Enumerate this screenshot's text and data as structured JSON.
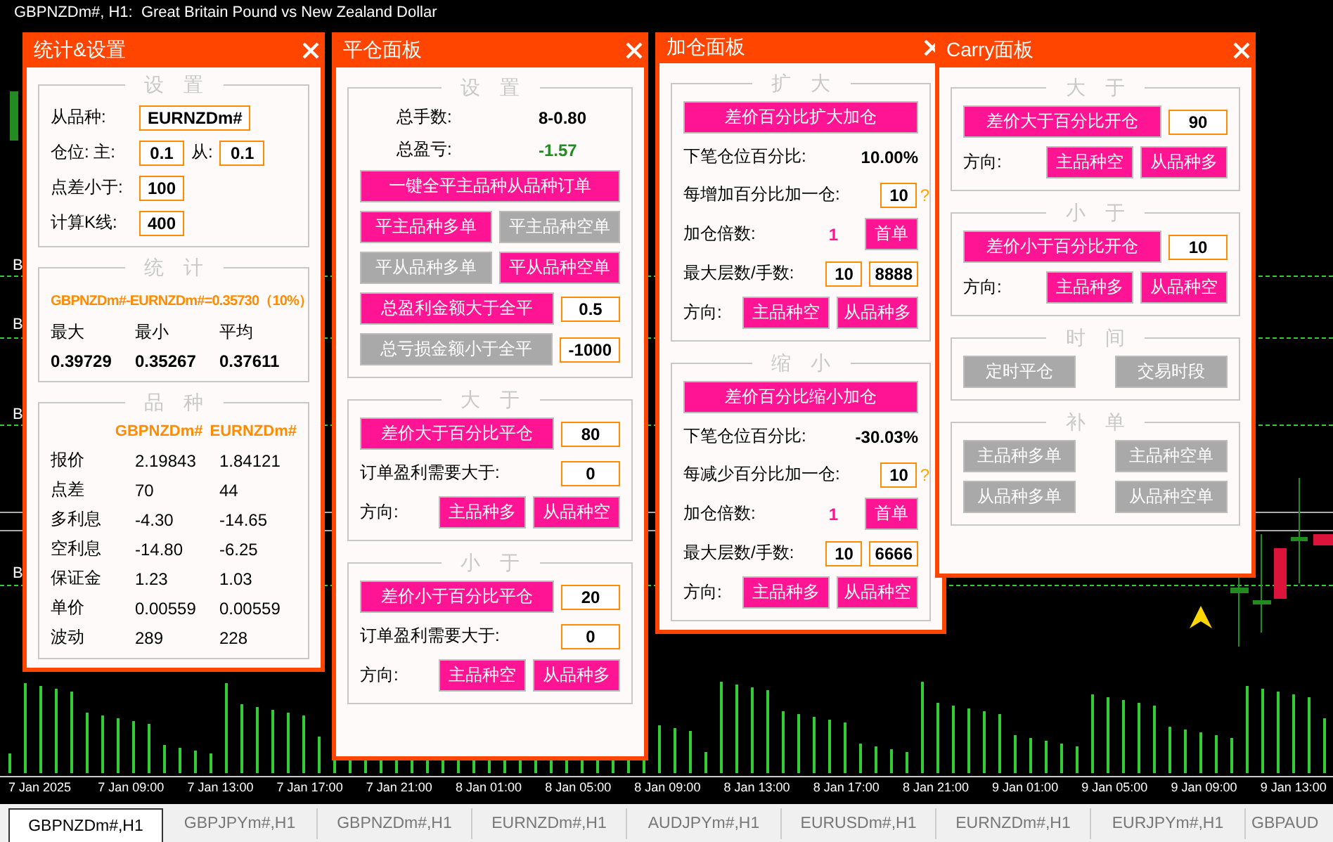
{
  "chart": {
    "title": "GBPNZDm#, H1:  Great Britain Pound vs New Zealand Dollar",
    "level_labels": [
      "B",
      "B",
      "B",
      "B"
    ],
    "time_axis": [
      "7 Jan 2025",
      "7 Jan 09:00",
      "7 Jan 13:00",
      "7 Jan 17:00",
      "7 Jan 21:00",
      "8 Jan 01:00",
      "8 Jan 05:00",
      "8 Jan 09:00",
      "8 Jan 13:00",
      "8 Jan 17:00",
      "8 Jan 21:00",
      "9 Jan 01:00",
      "9 Jan 05:00",
      "9 Jan 09:00",
      "9 Jan 13:00"
    ]
  },
  "panels": [
    {
      "title": "统计&设置",
      "sections": [
        {
          "title": "设置",
          "rows": [
            {
              "kind": "line",
              "items": [
                {
                  "kind": "label",
                  "text": "从品种:"
                },
                {
                  "kind": "field",
                  "value": "EURNZDm#"
                }
              ]
            },
            {
              "kind": "line",
              "items": [
                {
                  "kind": "label",
                  "text": "仓位: 主:"
                },
                {
                  "kind": "field",
                  "value": "0.1"
                },
                {
                  "kind": "label",
                  "text": "从:"
                },
                {
                  "kind": "field",
                  "value": "0.1"
                }
              ]
            },
            {
              "kind": "line",
              "items": [
                {
                  "kind": "label",
                  "text": "点差小于:"
                },
                {
                  "kind": "field",
                  "value": "100"
                }
              ]
            },
            {
              "kind": "line",
              "items": [
                {
                  "kind": "label",
                  "text": "计算K线:"
                },
                {
                  "kind": "field",
                  "value": "400"
                }
              ]
            }
          ]
        },
        {
          "title": "统计",
          "rows": [
            {
              "kind": "line",
              "items": [
                {
                  "kind": "headline",
                  "text": "GBPNZDm#-EURNZDm#=0.35730（10%）"
                }
              ]
            },
            {
              "kind": "grid",
              "items": [
                {
                  "kind": "label",
                  "text": "最大"
                },
                {
                  "kind": "label",
                  "text": "最小"
                },
                {
                  "kind": "label",
                  "text": "平均"
                }
              ]
            },
            {
              "kind": "grid",
              "items": [
                {
                  "kind": "value",
                  "text": "0.39729"
                },
                {
                  "kind": "value",
                  "text": "0.35267"
                },
                {
                  "kind": "value",
                  "text": "0.37611"
                }
              ]
            }
          ]
        },
        {
          "title": "品种",
          "rows": [
            {
              "kind": "grid",
              "items": [
                {
                  "kind": "spacer"
                },
                {
                  "kind": "headline",
                  "text": "GBPNZDm#"
                },
                {
                  "kind": "headline",
                  "text": "EURNZDm#"
                }
              ]
            },
            {
              "kind": "grid",
              "items": [
                {
                  "kind": "label",
                  "text": "报价"
                },
                {
                  "kind": "label",
                  "text": "2.19843"
                },
                {
                  "kind": "label",
                  "text": "1.84121"
                }
              ]
            },
            {
              "kind": "grid",
              "items": [
                {
                  "kind": "label",
                  "text": "点差"
                },
                {
                  "kind": "label",
                  "text": "70"
                },
                {
                  "kind": "label",
                  "text": "44"
                }
              ]
            },
            {
              "kind": "grid",
              "items": [
                {
                  "kind": "label",
                  "text": "多利息"
                },
                {
                  "kind": "label",
                  "text": "-4.30"
                },
                {
                  "kind": "label",
                  "text": "-14.65"
                }
              ]
            },
            {
              "kind": "grid",
              "items": [
                {
                  "kind": "label",
                  "text": "空利息"
                },
                {
                  "kind": "label",
                  "text": "-14.80"
                },
                {
                  "kind": "label",
                  "text": "-6.25"
                }
              ]
            },
            {
              "kind": "grid",
              "items": [
                {
                  "kind": "label",
                  "text": "保证金"
                },
                {
                  "kind": "label",
                  "text": "1.23"
                },
                {
                  "kind": "label",
                  "text": "1.03"
                }
              ]
            },
            {
              "kind": "grid",
              "items": [
                {
                  "kind": "label",
                  "text": "单价"
                },
                {
                  "kind": "label",
                  "text": "0.00559"
                },
                {
                  "kind": "label",
                  "text": "0.00559"
                }
              ]
            },
            {
              "kind": "grid",
              "items": [
                {
                  "kind": "label",
                  "text": "波动"
                },
                {
                  "kind": "label",
                  "text": "289"
                },
                {
                  "kind": "label",
                  "text": "228"
                }
              ]
            }
          ]
        }
      ]
    },
    {
      "title": "平仓面板",
      "sections": [
        {
          "title": "设置",
          "rows": [
            {
              "kind": "stat",
              "items": [
                {
                  "kind": "label",
                  "text": "总手数:"
                },
                {
                  "kind": "value",
                  "text": "8-0.80"
                }
              ]
            },
            {
              "kind": "stat",
              "items": [
                {
                  "kind": "label",
                  "text": "总盈亏:"
                },
                {
                  "kind": "gain",
                  "text": "-1.57"
                }
              ]
            },
            {
              "kind": "line",
              "items": [
                {
                  "kind": "button",
                  "label": "一键全平主品种从品种订单",
                  "on": true
                }
              ]
            },
            {
              "kind": "line",
              "items": [
                {
                  "kind": "button",
                  "label": "平主品种多单",
                  "on": true
                },
                {
                  "kind": "button",
                  "label": "平主品种空单",
                  "on": false
                }
              ]
            },
            {
              "kind": "line",
              "items": [
                {
                  "kind": "button",
                  "label": "平从品种多单",
                  "on": false
                },
                {
                  "kind": "button",
                  "label": "平从品种空单",
                  "on": true
                }
              ]
            },
            {
              "kind": "line",
              "items": [
                {
                  "kind": "button",
                  "label": "总盈利金额大于全平",
                  "on": true
                },
                {
                  "kind": "field",
                  "value": "0.5"
                }
              ]
            },
            {
              "kind": "line",
              "items": [
                {
                  "kind": "button",
                  "label": "总亏损金额小于全平",
                  "on": false
                },
                {
                  "kind": "field",
                  "value": "-1000"
                }
              ]
            }
          ]
        },
        {
          "title": "大于",
          "rows": [
            {
              "kind": "line",
              "items": [
                {
                  "kind": "button",
                  "label": "差价大于百分比平仓",
                  "on": true
                },
                {
                  "kind": "field",
                  "value": "80"
                }
              ]
            },
            {
              "kind": "line",
              "items": [
                {
                  "kind": "label",
                  "text": "订单盈利需要大于:"
                },
                {
                  "kind": "field",
                  "value": "0"
                }
              ]
            },
            {
              "kind": "line",
              "items": [
                {
                  "kind": "label",
                  "text": "方向:"
                },
                {
                  "kind": "button",
                  "label": "主品种多",
                  "on": true
                },
                {
                  "kind": "button",
                  "label": "从品种空",
                  "on": true
                }
              ]
            }
          ]
        },
        {
          "title": "小于",
          "rows": [
            {
              "kind": "line",
              "items": [
                {
                  "kind": "button",
                  "label": "差价小于百分比平仓",
                  "on": true
                },
                {
                  "kind": "field",
                  "value": "20"
                }
              ]
            },
            {
              "kind": "line",
              "items": [
                {
                  "kind": "label",
                  "text": "订单盈利需要大于:"
                },
                {
                  "kind": "field",
                  "value": "0"
                }
              ]
            },
            {
              "kind": "line",
              "items": [
                {
                  "kind": "label",
                  "text": "方向:"
                },
                {
                  "kind": "button",
                  "label": "主品种空",
                  "on": true
                },
                {
                  "kind": "button",
                  "label": "从品种多",
                  "on": true
                }
              ]
            }
          ]
        }
      ]
    },
    {
      "title": "加仓面板",
      "sections": [
        {
          "title": "扩大",
          "rows": [
            {
              "kind": "line",
              "items": [
                {
                  "kind": "button",
                  "label": "差价百分比扩大加仓",
                  "on": true
                }
              ]
            },
            {
              "kind": "line",
              "items": [
                {
                  "kind": "label",
                  "text": "下笔仓位百分比:"
                },
                {
                  "kind": "value",
                  "text": "10.00%"
                }
              ]
            },
            {
              "kind": "line",
              "items": [
                {
                  "kind": "label",
                  "text": "每增加百分比加一仓:"
                },
                {
                  "kind": "field",
                  "value": "10"
                },
                {
                  "kind": "hint",
                  "text": "?"
                }
              ]
            },
            {
              "kind": "line",
              "items": [
                {
                  "kind": "label",
                  "text": "加仓倍数:"
                },
                {
                  "kind": "count",
                  "text": "1"
                },
                {
                  "kind": "button",
                  "label": "首单",
                  "on": true
                }
              ]
            },
            {
              "kind": "line",
              "items": [
                {
                  "kind": "label",
                  "text": "最大层数/手数:"
                },
                {
                  "kind": "field",
                  "value": "10"
                },
                {
                  "kind": "field",
                  "value": "8888"
                }
              ]
            },
            {
              "kind": "line",
              "items": [
                {
                  "kind": "label",
                  "text": "方向:"
                },
                {
                  "kind": "button",
                  "label": "主品种空",
                  "on": true
                },
                {
                  "kind": "button",
                  "label": "从品种多",
                  "on": true
                }
              ]
            }
          ]
        },
        {
          "title": "缩小",
          "rows": [
            {
              "kind": "line",
              "items": [
                {
                  "kind": "button",
                  "label": "差价百分比缩小加仓",
                  "on": true
                }
              ]
            },
            {
              "kind": "line",
              "items": [
                {
                  "kind": "label",
                  "text": "下笔仓位百分比:"
                },
                {
                  "kind": "value",
                  "text": "-30.03%"
                }
              ]
            },
            {
              "kind": "line",
              "items": [
                {
                  "kind": "label",
                  "text": "每减少百分比加一仓:"
                },
                {
                  "kind": "field",
                  "value": "10"
                },
                {
                  "kind": "hint",
                  "text": "?"
                }
              ]
            },
            {
              "kind": "line",
              "items": [
                {
                  "kind": "label",
                  "text": "加仓倍数:"
                },
                {
                  "kind": "count",
                  "text": "1"
                },
                {
                  "kind": "button",
                  "label": "首单",
                  "on": true
                }
              ]
            },
            {
              "kind": "line",
              "items": [
                {
                  "kind": "label",
                  "text": "最大层数/手数:"
                },
                {
                  "kind": "field",
                  "value": "10"
                },
                {
                  "kind": "field",
                  "value": "6666"
                }
              ]
            },
            {
              "kind": "line",
              "items": [
                {
                  "kind": "label",
                  "text": "方向:"
                },
                {
                  "kind": "button",
                  "label": "主品种多",
                  "on": true
                },
                {
                  "kind": "button",
                  "label": "从品种空",
                  "on": true
                }
              ]
            }
          ]
        }
      ]
    },
    {
      "title": "Carry面板",
      "sections": [
        {
          "title": "大于",
          "rows": [
            {
              "kind": "line",
              "items": [
                {
                  "kind": "button",
                  "label": "差价大于百分比开仓",
                  "on": true
                },
                {
                  "kind": "field",
                  "value": "90"
                }
              ]
            },
            {
              "kind": "line",
              "items": [
                {
                  "kind": "label",
                  "text": "方向:"
                },
                {
                  "kind": "button",
                  "label": "主品种空",
                  "on": true
                },
                {
                  "kind": "button",
                  "label": "从品种多",
                  "on": true
                }
              ]
            }
          ]
        },
        {
          "title": "小于",
          "rows": [
            {
              "kind": "line",
              "items": [
                {
                  "kind": "button",
                  "label": "差价小于百分比开仓",
                  "on": true
                },
                {
                  "kind": "field",
                  "value": "10"
                }
              ]
            },
            {
              "kind": "line",
              "items": [
                {
                  "kind": "label",
                  "text": "方向:"
                },
                {
                  "kind": "button",
                  "label": "主品种多",
                  "on": true
                },
                {
                  "kind": "button",
                  "label": "从品种空",
                  "on": true
                }
              ]
            }
          ]
        },
        {
          "title": "时间",
          "rows": [
            {
              "kind": "pair",
              "items": [
                {
                  "kind": "button",
                  "label": "定时平仓",
                  "on": false
                },
                {
                  "kind": "button",
                  "label": "交易时段",
                  "on": false
                }
              ]
            }
          ]
        },
        {
          "title": "补单",
          "rows": [
            {
              "kind": "pair",
              "items": [
                {
                  "kind": "button",
                  "label": "主品种多单",
                  "on": false
                },
                {
                  "kind": "button",
                  "label": "主品种空单",
                  "on": false
                }
              ]
            },
            {
              "kind": "pair",
              "items": [
                {
                  "kind": "button",
                  "label": "从品种多单",
                  "on": false
                },
                {
                  "kind": "button",
                  "label": "从品种空单",
                  "on": false
                }
              ]
            }
          ]
        }
      ]
    }
  ],
  "tabs": [
    {
      "label": "GBPNZDm#,H1",
      "selected": true
    },
    {
      "label": "GBPJPYm#,H1",
      "selected": false
    },
    {
      "label": "GBPNZDm#,H1",
      "selected": false
    },
    {
      "label": "EURNZDm#,H1",
      "selected": false
    },
    {
      "label": "AUDJPYm#,H1",
      "selected": false
    },
    {
      "label": "EURUSDm#,H1",
      "selected": false
    },
    {
      "label": "EURNZDm#,H1",
      "selected": false
    },
    {
      "label": "EURJPYm#,H1",
      "selected": false
    },
    {
      "label": "GBPAUD",
      "selected": false
    }
  ]
}
